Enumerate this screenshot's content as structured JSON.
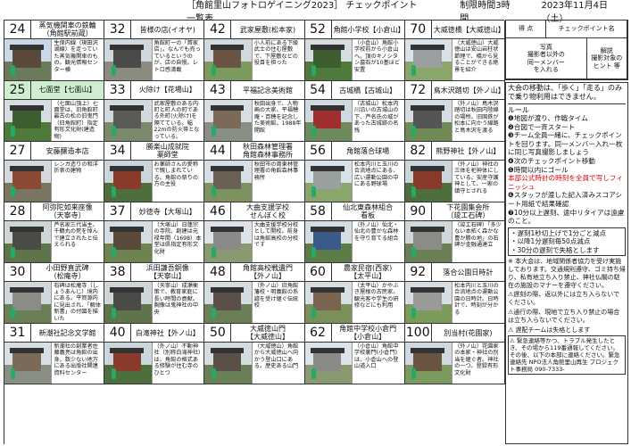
{
  "header": {
    "title": "［角館里山フォトロゲイニング2023］ チェックポイント一覧表",
    "limit": "制限時間3時間",
    "date": "2023年11月4日（土）"
  },
  "legend": {
    "points_label": "得 点",
    "name_label": "チェックポイント名",
    "photo_label": "写真\n撮影者以外の\n同一メンバー\nを入れる",
    "explain_label": "解説\n撮影対象の\nヒント 等"
  },
  "rules": {
    "intro": "大会の移動は、「歩く」「走る」のみで乗り物利用はできません。",
    "title": "ルール",
    "items": [
      "❶地図が渡り、作戦タイム",
      "❷合図で一斉スタート",
      "❸チーム全員一緒に、チェックポイントを回ります。同一メンバー入れ一枚に同じ写真撮影しましょう",
      "❹次のチェックポイント移動",
      "❺時間以内にゴール",
      "本部公式時計の時刻を全員で写しフィニッシュ",
      "❻スタッフが渡した記入済みスコアシート用紙で結果確認",
      "❼10分以上遅刻、途中リタイアは遠慮のこと。"
    ],
    "penalties": [
      "・遅刻1秒切上げで1分ごと減点",
      "・以降1分遅刻毎50点減点",
      "・30分の遅刻で失格とします"
    ],
    "note1": "※ 本大会は、地域関係者協力を受け実施しております。交通規則遵守、ゴミ持ち帰り、私有地立ち入り禁止、神社仏閣の駐在の施設のマナーを遵守ください。",
    "note2": "⚠遅刻の際、返以外には立ち入らないでください。",
    "note3": "⚠通行の際、現地で立ち入り禁止の場合は立ち入らないでください。",
    "note4": "⚠ 遅配チームは失格とします",
    "emergency": "⚠ 緊急連絡等かつ、トラブル発生したとき、その場から119番通報してください。その後、以下の本部に連絡ください。緊急連絡先 NPO法人角館里山再生 プロジェクト事務局 090-7333-"
  },
  "checkpoints": [
    {
      "num": "24",
      "name": "蒸気機関車の鉄輪\n（角館駅前蔵）",
      "desc": "生保内線（現田沢湖線）を走っていた蒸気機関車のもの。観光情報センター横",
      "green": false,
      "photo": "station"
    },
    {
      "num": "32",
      "name": "皆様の店(イオヤ)",
      "desc": "角館町一の「首家店」。なんでも売っているというのが、店の自慢。レトロ感満載",
      "green": false,
      "photo": "shop"
    },
    {
      "num": "42",
      "name": "武家屋敷(松本家)",
      "desc": "小人前にある下級武士の住む屋敷で、下屋敷などの役目を担った",
      "green": false,
      "photo": "house"
    },
    {
      "num": "52",
      "name": "角館小学校【小倉山】",
      "desc": "（小倉山）角館小学校前から小倉山へ。頂のキノシタン墓石が10基ほど安置",
      "green": false,
      "photo": "forest"
    },
    {
      "num": "70",
      "name": "大威徳橋【大威徳山】",
      "desc": "（大威徳山）大威徳山は安山岩柱状節理で、橋から見ることができる絶景を紹介",
      "green": false,
      "photo": "field"
    },
    {
      "num": "25",
      "name": "七面堂【七面山】",
      "desc": "（七面山頂上）七面堂は、旧角館町最古の松の旧鬼門（旧角館町）指定有形文化財(建造物)",
      "green": true,
      "photo": "forest"
    },
    {
      "num": "33",
      "name": "火除け【花場山】",
      "desc": "武家屋敷のある内町と町人の町である外町(火除け)を隔てている。幅22mの防火帯となっている。",
      "green": false,
      "photo": "street"
    },
    {
      "num": "43",
      "name": "平福記念美術館",
      "desc": "秋田出身で、人物画の大家、平福穂庵・百穂を記念した美術館。1988年開館",
      "green": false,
      "photo": "museum"
    },
    {
      "num": "54",
      "name": "古城橋【古城山】",
      "desc": "（古城山）松本内川沿いの古城山の下、芦名氏の城があった古城跡の名残",
      "green": false,
      "photo": "bridge"
    },
    {
      "num": "72",
      "name": "鳥木沢踏切【外ノ山】",
      "desc": "（外ノ山）鳥木沢踏切は秋田内陸線の場所。旧国鉄が松本に向かう線路と鳥木沢を渡る",
      "green": false,
      "photo": "rail"
    },
    {
      "num": "27",
      "name": "安藤醸造本店",
      "desc": "レンガ造りの和洋折衷の建物",
      "green": false,
      "photo": "brick"
    },
    {
      "num": "34",
      "name": "勝楽山成就院\n薬師堂",
      "desc": "お薬師さんの愛称で親しまれている。角館の祭りの方の主役",
      "green": false,
      "photo": "shrine"
    },
    {
      "num": "44",
      "name": "秋田森林管理署\n角館森林事務所",
      "desc": "秋田市の周東林管理署の角館森林事務所",
      "green": false,
      "photo": "office"
    },
    {
      "num": "56",
      "name": "角館落合球場",
      "desc": "松本内川と玉川の合流地点にある、広い運動公園の中にある野球場",
      "green": false,
      "photo": "field"
    },
    {
      "num": "82",
      "name": "熊野神社【外ノ山】",
      "desc": "（外ノ山）神社の三体を祀神体にしている。安産守護神として、一家の鎮守とされる",
      "green": false,
      "photo": "shrine"
    },
    {
      "num": "28",
      "name": "阿弥陀如来座像\n（天寧寺）",
      "desc": "芦名家三代当主、千鶴丸の死を悼んで建立されたと伝えられる",
      "green": false,
      "photo": "statue"
    },
    {
      "num": "37",
      "name": "妙徳寺【大塚山】",
      "desc": "（大塚山）日蓮宗の寺院。創建は元禄年間（1698）本堂は県指定有形文化財",
      "green": false,
      "photo": "temple"
    },
    {
      "num": "46",
      "name": "大曲支援学校\nせんぼく校",
      "desc": "大曲支援学校分校として開校。前身は角館高校の分校です",
      "green": false,
      "photo": "school"
    },
    {
      "num": "58",
      "name": "仙北東森林組合\n看板",
      "desc": "（外ノ山）仙北・仙北の豊かな森林を守り育てる組合",
      "green": false,
      "photo": "sign"
    },
    {
      "num": "90",
      "name": "下花園集会所\n（竣工石碑）",
      "desc": "（竣工石碑）「多少ない本拓く森かな豊か勝の地」の石碑が金融通達立",
      "green": false,
      "photo": "stone"
    },
    {
      "num": "30",
      "name": "小田野直武碑\n（松庵寺）",
      "desc": "石碑は松庵寺（しょうあんじ）境内にある。平賀源内に見出され、「解体新書」の付図を描いた",
      "green": false,
      "photo": "stone"
    },
    {
      "num": "38",
      "name": "浜田謙吾銅像\n【天寧山】",
      "desc": "（天寧山）成瀬衡策で、教育家庭に長い時間の貢献。胸像は鬼神社の中央",
      "green": false,
      "photo": "statue"
    },
    {
      "num": "48",
      "name": "角館高校戦遺門\n【外ノ山】",
      "desc": "（外ノ山）旧角館藩校・明義館の系譜を受け継ぐ伝統校",
      "green": false,
      "photo": "gate"
    },
    {
      "num": "60",
      "name": "農家民宿(西家)\n【太平山】",
      "desc": "（太平山）かやぶき屋根の古民家。観光客や学生の研修などにも利用",
      "green": false,
      "photo": "farm"
    },
    {
      "num": "92",
      "name": "落合公園日時計",
      "desc": "松本内川と玉川の合流地点の運動公園の日時計。日時計で、時刻が分かる",
      "green": false,
      "photo": "park"
    },
    {
      "num": "31",
      "name": "新潮社記念文学館",
      "desc": "新潮社の創業者佐藤義亮は角館の出身。数少ない地方にある出版社関連資料センター",
      "green": false,
      "photo": "museum"
    },
    {
      "num": "40",
      "name": "白滝神社【外ノ山】",
      "desc": "（外ノ山）不動神社（別称白滝神社）は、角館の格式ある修験が住む寺のひとつ",
      "green": false,
      "photo": "shrine"
    },
    {
      "num": "50",
      "name": "大威徳山門\n【大威徳山】",
      "desc": "（大威徳山）角館から大威徳山へ向かう登山口にある。歴史ある山門",
      "green": false,
      "photo": "gate"
    },
    {
      "num": "62",
      "name": "角館中学校小倉門\n【小倉山】",
      "desc": "（小倉山）角館中学校裏門(小倉門)は、小倉山への登山道入口",
      "green": false,
      "photo": "school"
    },
    {
      "num": "100",
      "name": "別当村(花園家)",
      "desc": "（外ノ山）花園家の本家・神社の別当を継ぐ者。神社の一つ。登録有形文化財",
      "green": false,
      "photo": "house"
    }
  ]
}
